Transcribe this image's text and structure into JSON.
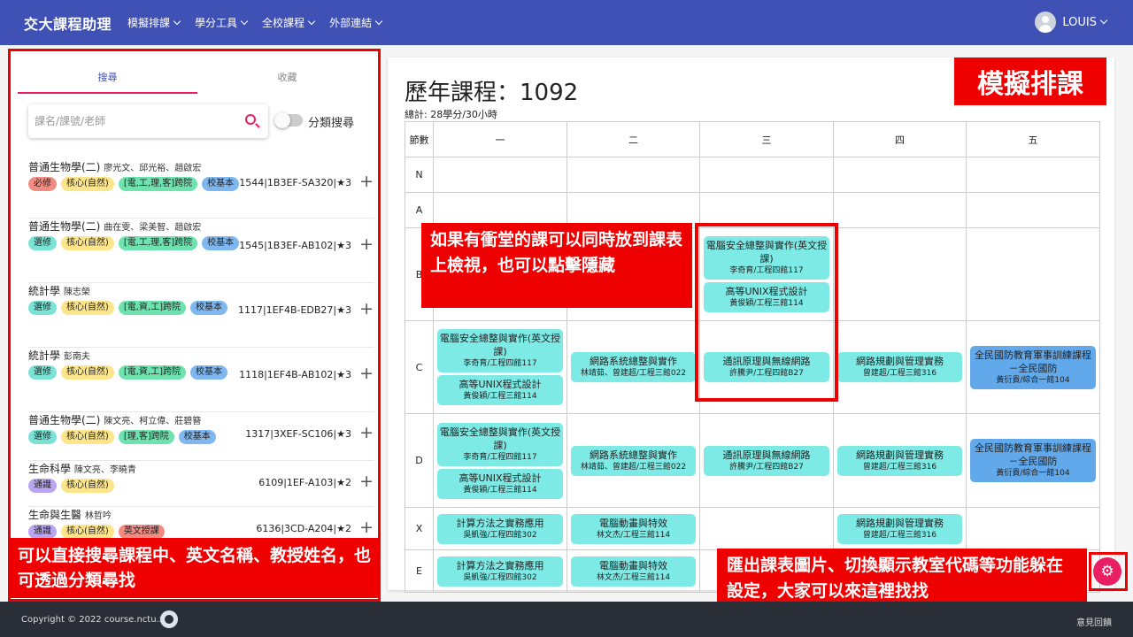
{
  "header": {
    "brand": "交大課程助理",
    "nav": [
      "模擬排課",
      "學分工具",
      "全校課程",
      "外部連結"
    ],
    "user": "LOUIS"
  },
  "sidebar": {
    "tabs": [
      "搜尋",
      "收藏"
    ],
    "search_placeholder": "課名/課號/老師",
    "toggle_label": "分類搜尋",
    "courses": [
      {
        "name": "普通生物學(二)",
        "teachers": "廖光文、邱光裕、趙啟宏",
        "tags": [
          {
            "t": "必修",
            "c": "#f28b82"
          },
          {
            "t": "核心(自然)",
            "c": "#fde58c"
          },
          {
            "t": "[電,工,理,客]跨院",
            "c": "#6ee3b0"
          },
          {
            "t": "校基本",
            "c": "#7fb8f0"
          }
        ],
        "info": "1544|1B3EF-SA320|★3"
      },
      {
        "name": "普通生物學(二)",
        "teachers": "曲在雯、梁美智、趙啟宏",
        "tags": [
          {
            "t": "選修",
            "c": "#7be3d6"
          },
          {
            "t": "核心(自然)",
            "c": "#fde58c"
          },
          {
            "t": "[電,工,理,客]跨院",
            "c": "#6ee3b0"
          },
          {
            "t": "校基本",
            "c": "#7fb8f0"
          }
        ],
        "info": "1545|1B3EF-AB102|★3"
      },
      {
        "name": "統計學",
        "teachers": "陳志榮",
        "tags": [
          {
            "t": "選修",
            "c": "#7be3d6"
          },
          {
            "t": "核心(自然)",
            "c": "#fde58c"
          },
          {
            "t": "[電,資,工]跨院",
            "c": "#6ee3b0"
          },
          {
            "t": "校基本",
            "c": "#7fb8f0"
          }
        ],
        "info": "1117|1EF4B-EDB27|★3"
      },
      {
        "name": "統計學",
        "teachers": "彭南夫",
        "tags": [
          {
            "t": "選修",
            "c": "#7be3d6"
          },
          {
            "t": "核心(自然)",
            "c": "#fde58c"
          },
          {
            "t": "[電,資,工]跨院",
            "c": "#6ee3b0"
          },
          {
            "t": "校基本",
            "c": "#7fb8f0"
          }
        ],
        "info": "1118|1EF4B-AB102|★3"
      },
      {
        "name": "普通生物學(二)",
        "teachers": "陳文亮、柯立偉、莊碧簪",
        "tags": [
          {
            "t": "選修",
            "c": "#7be3d6"
          },
          {
            "t": "核心(自然)",
            "c": "#fde58c"
          },
          {
            "t": "[理,客]跨院",
            "c": "#6ee3b0"
          },
          {
            "t": "校基本",
            "c": "#7fb8f0"
          }
        ],
        "info": "1317|3XEF-SC106|★3"
      },
      {
        "name": "生命科學",
        "teachers": "陳文亮、李曉青",
        "tags": [
          {
            "t": "通識",
            "c": "#b9a5f0"
          },
          {
            "t": "核心(自然)",
            "c": "#fde58c"
          }
        ],
        "info": "6109|1EF-A103|★2"
      },
      {
        "name": "生命與生醫",
        "teachers": "林哲吟",
        "tags": [
          {
            "t": "通識",
            "c": "#b9a5f0"
          },
          {
            "t": "核心(自然)",
            "c": "#fde58c"
          },
          {
            "t": "英文授課",
            "c": "#f28b82"
          }
        ],
        "info": "6136|3CD-A204|★2"
      }
    ]
  },
  "callouts": {
    "left": "可以直接搜尋課程中、英文名稱、教授姓名，也可透過分類尋找",
    "mid": "如果有衝堂的課可以同時放到課表上檢視，也可以點擊隱藏",
    "title": "模擬排課",
    "settings": "匯出課表圖片、切換顯示教室代碼等功能躲在設定，大家可以來這裡找找"
  },
  "schedule": {
    "title": "歷年課程：1092",
    "summary": "總計: 28學分/30小時",
    "header": [
      "節數",
      "一",
      "二",
      "三",
      "四",
      "五"
    ],
    "rows": [
      {
        "period": "N",
        "cells": [
          [],
          [],
          [],
          [],
          []
        ]
      },
      {
        "period": "A",
        "cells": [
          [],
          [],
          [],
          [],
          []
        ]
      },
      {
        "period": "B",
        "cells": [
          [],
          [],
          [
            {
              "n": "電腦安全總整與實作(英文授課)",
              "l": "李奇育/工程四館117"
            },
            {
              "n": "高等UNIX程式設計",
              "l": "黃俊穎/工程三館114"
            }
          ],
          [],
          []
        ]
      },
      {
        "period": "C",
        "cells": [
          [
            {
              "n": "電腦安全總整與實作(英文授課)",
              "l": "李奇育/工程四館117"
            },
            {
              "n": "高等UNIX程式設計",
              "l": "黃俊穎/工程三館114"
            }
          ],
          [
            {
              "n": "網路系統總整與實作",
              "l": "林靖茹、曾建超/工程三館022"
            }
          ],
          [
            {
              "n": "通訊原理與無線網路",
              "l": "許騰尹/工程四館B27"
            }
          ],
          [
            {
              "n": "網路規劃與管理實務",
              "l": "曾建超/工程三館316"
            }
          ],
          [
            {
              "n": "全民國防教育軍事訓練課程－全民國防",
              "l": "黃衍貴/綜合一館104",
              "b": 1
            }
          ]
        ]
      },
      {
        "period": "D",
        "cells": [
          [
            {
              "n": "電腦安全總整與實作(英文授課)",
              "l": "李奇育/工程四館117"
            },
            {
              "n": "高等UNIX程式設計",
              "l": "黃俊穎/工程三館114"
            }
          ],
          [
            {
              "n": "網路系統總整與實作",
              "l": "林靖茹、曾建超/工程三館022"
            }
          ],
          [
            {
              "n": "通訊原理與無線網路",
              "l": "許騰尹/工程四館B27"
            }
          ],
          [
            {
              "n": "網路規劃與管理實務",
              "l": "曾建超/工程三館316"
            }
          ],
          [
            {
              "n": "全民國防教育軍事訓練課程－全民國防",
              "l": "黃衍貴/綜合一館104",
              "b": 1
            }
          ]
        ]
      },
      {
        "period": "X",
        "cells": [
          [
            {
              "n": "計算方法之實務應用",
              "l": "吳凱強/工程四館302"
            }
          ],
          [
            {
              "n": "電腦動畫與特效",
              "l": "林文杰/工程三館114"
            }
          ],
          [],
          [
            {
              "n": "網路規劃與管理實務",
              "l": "曾建超/工程三館316"
            }
          ],
          []
        ]
      },
      {
        "period": "E",
        "cells": [
          [
            {
              "n": "計算方法之實務應用",
              "l": "吳凱強/工程四館302"
            }
          ],
          [
            {
              "n": "電腦動畫與特效",
              "l": "林文杰/工程三館114"
            }
          ],
          [],
          [],
          []
        ]
      }
    ]
  },
  "footer": {
    "copyright": "Copyright © 2022 course.nctu.xyz",
    "feedback": "意見回饋"
  },
  "icons": {
    "settings": "gear-icon",
    "github": "github-icon",
    "search": "search-icon",
    "user": "account-icon"
  }
}
